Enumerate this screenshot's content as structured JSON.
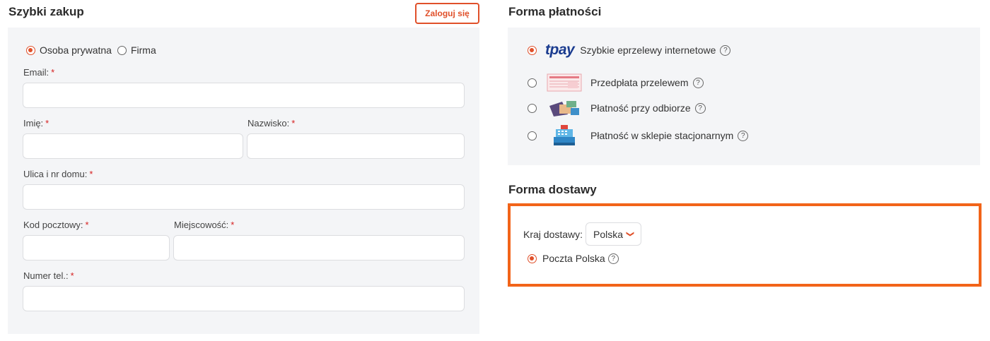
{
  "quick_buy": {
    "title": "Szybki zakup",
    "login_label": "Zaloguj się",
    "customer_types": [
      {
        "label": "Osoba prywatna",
        "checked": true
      },
      {
        "label": "Firma",
        "checked": false
      }
    ],
    "required_mark": "*",
    "fields": {
      "email": {
        "label": "Email:",
        "value": ""
      },
      "first_name": {
        "label": "Imię:",
        "value": ""
      },
      "last_name": {
        "label": "Nazwisko:",
        "value": ""
      },
      "street": {
        "label": "Ulica i nr domu:",
        "value": ""
      },
      "postal_code": {
        "label": "Kod pocztowy:",
        "value": ""
      },
      "city": {
        "label": "Miejscowość:",
        "value": ""
      },
      "phone": {
        "label": "Numer tel.:",
        "value": ""
      }
    }
  },
  "payment": {
    "title": "Forma płatności",
    "help_glyph": "?",
    "methods": [
      {
        "label": "Szybkie eprzelewy internetowe",
        "logo_text": "tpay",
        "icon": "tpay-logo",
        "checked": true
      },
      {
        "label": "Przedpłata przelewem",
        "icon": "bank-transfer-form-icon",
        "checked": false
      },
      {
        "label": "Płatność przy odbiorze",
        "icon": "cash-on-delivery-icon",
        "checked": false
      },
      {
        "label": "Płatność w sklepie stacjonarnym",
        "icon": "cash-register-icon",
        "checked": false
      }
    ]
  },
  "delivery": {
    "title": "Forma dostawy",
    "country_label": "Kraj dostawy:",
    "country_value": "Polska",
    "options": [
      {
        "label": "Poczta Polska",
        "checked": true
      }
    ]
  },
  "colors": {
    "accent": "#e0502a",
    "highlight_border": "#f26419",
    "panel_bg": "#f4f5f7",
    "required": "#d62020",
    "tpay_blue": "#1a3b8f"
  }
}
